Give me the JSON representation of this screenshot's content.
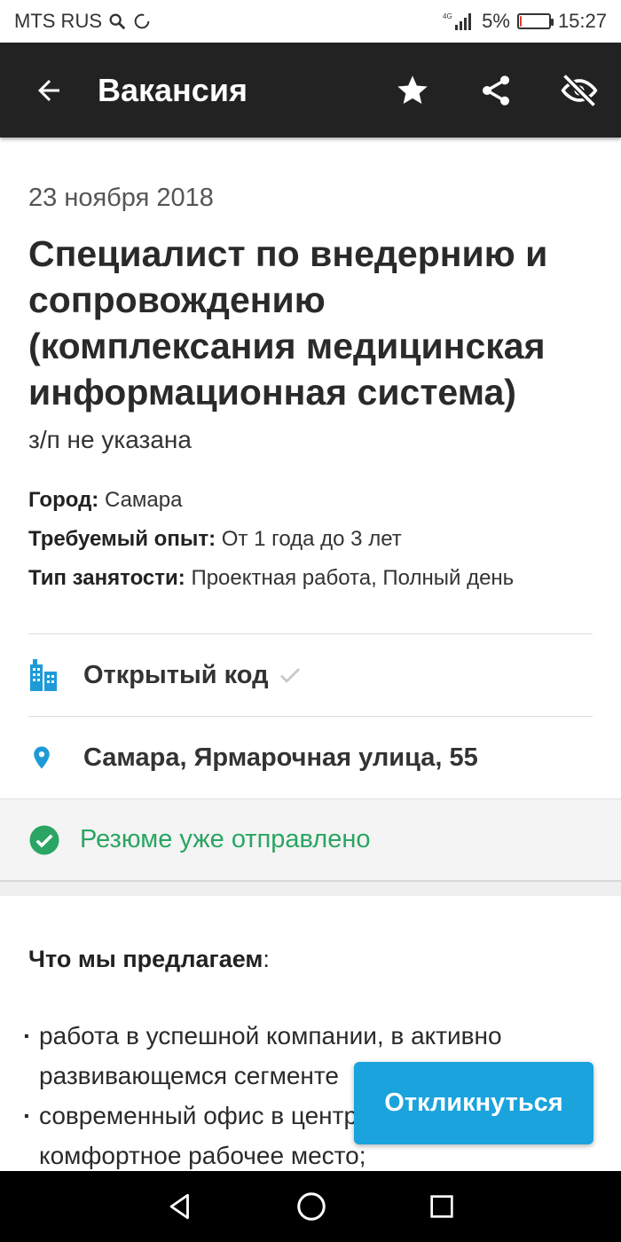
{
  "status_bar": {
    "carrier": "MTS RUS",
    "network": "4G",
    "battery_percent": "5%",
    "battery_level": 0.05,
    "time": "15:27"
  },
  "app_bar": {
    "title": "Вакансия",
    "icons": [
      "back-arrow-icon",
      "star-icon",
      "share-icon",
      "eye-off-icon"
    ]
  },
  "vacancy": {
    "date": "23 ноября 2018",
    "title": "Специалист по внедернию и сопровождению (комплексания медицинская информационная система)",
    "salary": "з/п не указана",
    "city_label": "Город:",
    "city_value": "Самара",
    "experience_label": "Требуемый опыт:",
    "experience_value": "От 1 года до 3 лет",
    "employment_label": "Тип занятости:",
    "employment_value": "Проектная работа, Полный день"
  },
  "company": {
    "name": "Открытый код",
    "address": "Самара, Ярмарочная улица, 55"
  },
  "application": {
    "status": "Резюме уже отправлено"
  },
  "description": {
    "heading": "Что мы предлагаем",
    "heading_suffix": ":",
    "items": [
      "работа в успешной компании, в активно развивающемся сегменте",
      "современный офис в центре города, комфортное рабочее место;"
    ]
  },
  "respond_button": "Откликнуться",
  "colors": {
    "app_bar": "#222222",
    "accent": "#1aa3dd",
    "success": "#2aa563",
    "icon_blue": "#1e9bd7"
  }
}
